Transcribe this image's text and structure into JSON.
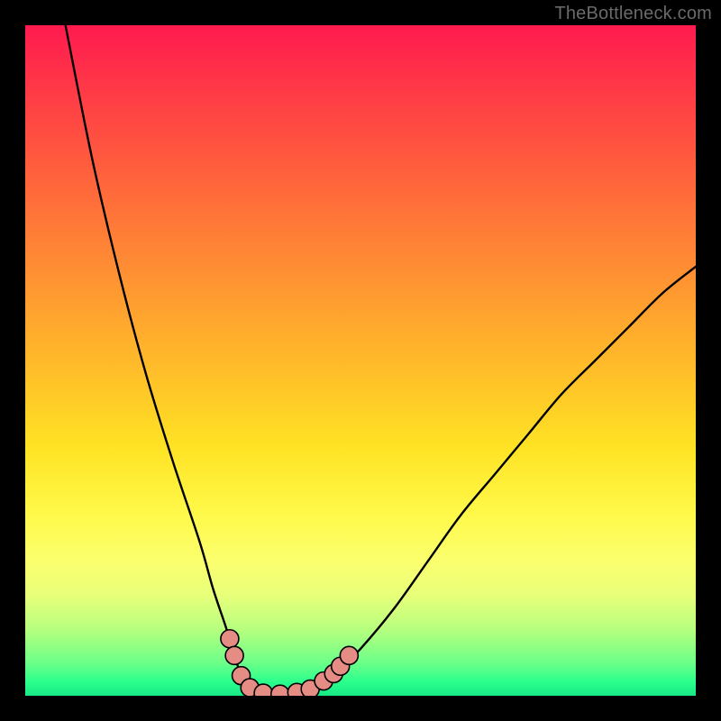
{
  "watermark": "TheBottleneck.com",
  "colors": {
    "frame": "#000000",
    "curve_stroke": "#000000",
    "marker_fill": "#e58c84",
    "marker_stroke": "#000000",
    "gradient_stops": [
      "#ff1a4f",
      "#ff3448",
      "#ff5a3e",
      "#ff8a34",
      "#ffb92a",
      "#ffe324",
      "#fff94a",
      "#fbff6e",
      "#e8ff7a",
      "#b8ff7e",
      "#6dff88",
      "#2aff8c",
      "#17e886"
    ]
  },
  "chart_data": {
    "type": "line",
    "title": "",
    "xlabel": "",
    "ylabel": "",
    "xlim": [
      0,
      100
    ],
    "ylim": [
      0,
      100
    ],
    "grid": false,
    "legend": false,
    "series": [
      {
        "name": "curve",
        "x": [
          6,
          10,
          14,
          18,
          22,
          26,
          28,
          30,
          31.5,
          33,
          35,
          38,
          42,
          46,
          50,
          55,
          60,
          65,
          70,
          75,
          80,
          85,
          90,
          95,
          100
        ],
        "y": [
          100,
          80,
          63,
          48,
          35,
          23,
          16,
          10,
          5,
          1.5,
          0.4,
          0.2,
          0.8,
          3,
          7,
          13,
          20,
          27,
          33,
          39,
          45,
          50,
          55,
          60,
          64
        ]
      }
    ],
    "markers": [
      {
        "x": 30.5,
        "y": 8.5
      },
      {
        "x": 31.2,
        "y": 6.0
      },
      {
        "x": 32.2,
        "y": 3.0
      },
      {
        "x": 33.5,
        "y": 1.2
      },
      {
        "x": 35.5,
        "y": 0.4
      },
      {
        "x": 38.0,
        "y": 0.25
      },
      {
        "x": 40.5,
        "y": 0.5
      },
      {
        "x": 42.5,
        "y": 1.0
      },
      {
        "x": 44.5,
        "y": 2.2
      },
      {
        "x": 46.0,
        "y": 3.3
      },
      {
        "x": 47.0,
        "y": 4.4
      },
      {
        "x": 48.3,
        "y": 6.0
      }
    ],
    "note": "Axes unlabeled in source image; x and y are 0–100 proportional plot coordinates (0,0 at bottom-left). Values are estimated from pixel positions."
  }
}
